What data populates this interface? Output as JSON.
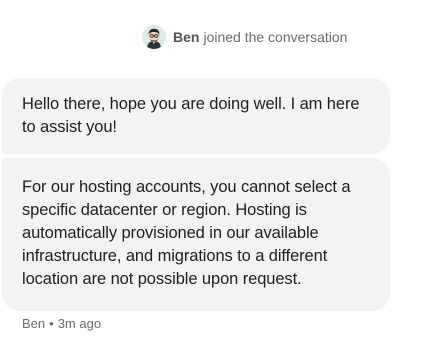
{
  "conversation": {
    "join_notice": {
      "avatar_icon": "agent-avatar-icon",
      "name": "Ben",
      "text": "joined the conversation"
    },
    "messages": [
      {
        "text": "Hello there, hope you are doing well. I am here to assist you!"
      },
      {
        "text": "For our hosting accounts, you cannot select a specific datacenter or region. Hosting is automatically provisioned in our available infrastructure, and migrations to a different location are not possible upon request."
      }
    ],
    "meta": {
      "author": "Ben",
      "separator": "•",
      "time": "3m ago"
    }
  },
  "colors": {
    "bubble_background": "#f3f3f3",
    "muted_text": "#6b6b6b",
    "message_text": "#1e1e1e"
  }
}
